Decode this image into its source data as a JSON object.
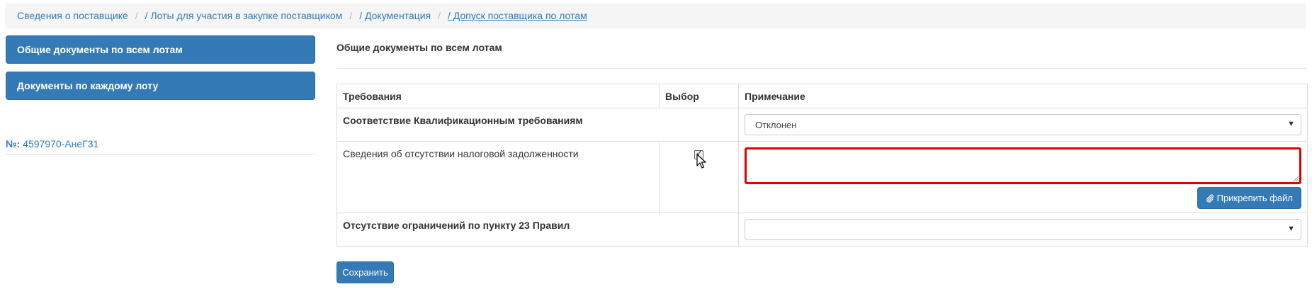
{
  "breadcrumb": [
    {
      "label": "Сведения о поставщике"
    },
    {
      "label": "/ Лоты для участия в закупке поставщиком"
    },
    {
      "label": "/ Документация"
    },
    {
      "label": "/ Допуск поставщика по лотам"
    }
  ],
  "sidebar": {
    "buttons": [
      {
        "label": "Общие документы по всем лотам"
      },
      {
        "label": "Документы по каждому лоту"
      }
    ],
    "lot_prefix": "№:",
    "lot_number": "4597970-АнеГ31"
  },
  "main": {
    "section_title": "Общие документы по всем лотам",
    "table": {
      "headers": [
        "Требования",
        "Выбор",
        "Примечание"
      ],
      "rows": [
        {
          "requirement": "Соответствие Квалификационным требованиям",
          "control": "select",
          "value": "Отклонен"
        },
        {
          "requirement": "Сведения об отсутствии налоговой задолженности",
          "control": "checkbox",
          "checked": true,
          "note_value": "",
          "attach_label": "Прикрепить файл"
        },
        {
          "requirement": "Отсутствие ограничений по пункту 23 Правил",
          "control": "select",
          "value": ""
        }
      ]
    },
    "save_label": "Сохранить"
  },
  "icons": {
    "select_caret": "caret-down-icon",
    "attach": "paperclip-icon",
    "pointer": "mouse-pointer-icon"
  },
  "colors": {
    "primary": "#337ab7",
    "highlight_border": "#e00000",
    "breadcrumb_bg": "#f5f5f5"
  }
}
